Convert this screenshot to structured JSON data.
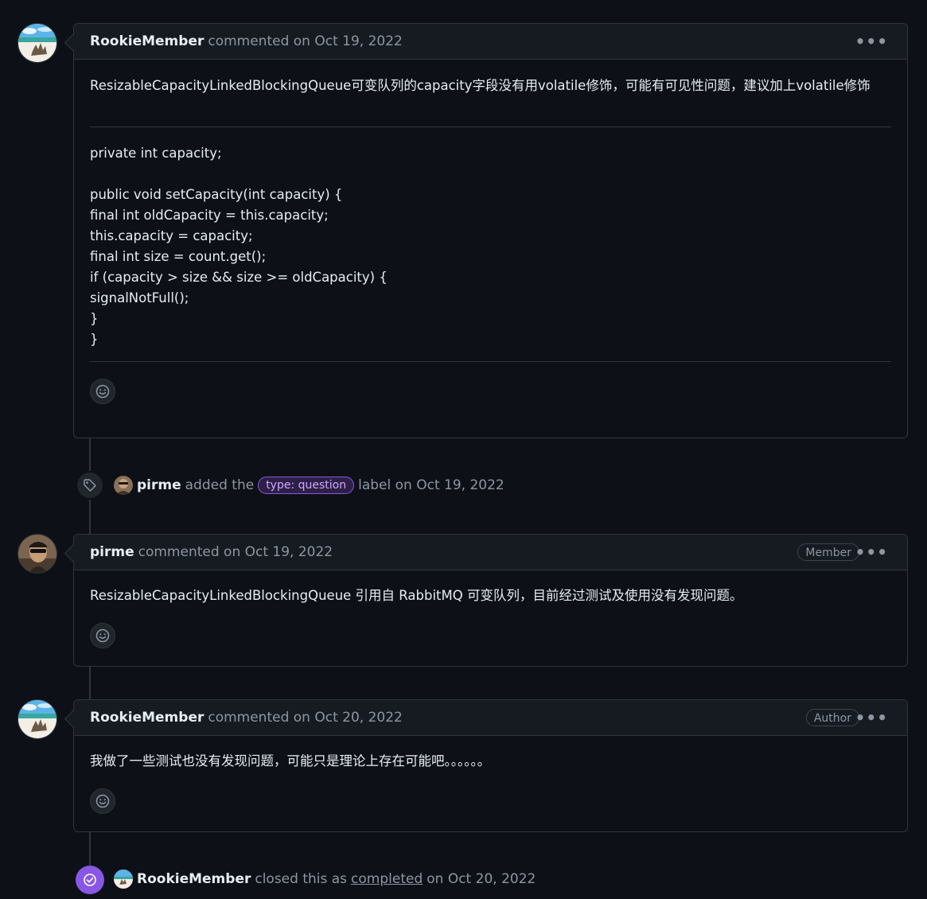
{
  "colors": {
    "background": "#0d1117",
    "header_bg": "#161b22",
    "border": "#30363d",
    "text": "#e6edf3",
    "muted": "#8d96a0",
    "closed_purple": "#8957e5",
    "label_text": "#d2a8ff"
  },
  "comment1": {
    "author": "RookieMember",
    "meta": "commented on Oct 19, 2022",
    "body_line": "ResizableCapacityLinkedBlockingQueue可变队列的capacity字段没有用volatile修饰，可能有可见性问题，建议加上volatile修饰",
    "code": "private int capacity;\n\npublic void setCapacity(int capacity) {\nfinal int oldCapacity = this.capacity;\nthis.capacity = capacity;\nfinal int size = count.get();\nif (capacity > size && size >= oldCapacity) {\nsignalNotFull();\n}\n}",
    "menu_icon": "kebab-horizontal-icon",
    "reaction_icon": "smiley-icon"
  },
  "label_event": {
    "actor": "pirme",
    "action": "added the",
    "label": "type: question",
    "suffix": "label on Oct 19, 2022",
    "icon": "tag-icon"
  },
  "comment2": {
    "author": "pirme",
    "meta": "commented on Oct 19, 2022",
    "badge": "Member",
    "body_line": "ResizableCapacityLinkedBlockingQueue 引用自 RabbitMQ 可变队列，目前经过测试及使用没有发现问题。"
  },
  "comment3": {
    "author": "RookieMember",
    "meta": "commented on Oct 20, 2022",
    "badge": "Author",
    "body_line": "我做了一些测试也没有发现问题，可能只是理论上存在可能吧。。。。。。"
  },
  "close_event": {
    "actor": "RookieMember",
    "action": "closed this as",
    "reason": "completed",
    "suffix": "on Oct 20, 2022",
    "icon": "check-circle-icon"
  }
}
